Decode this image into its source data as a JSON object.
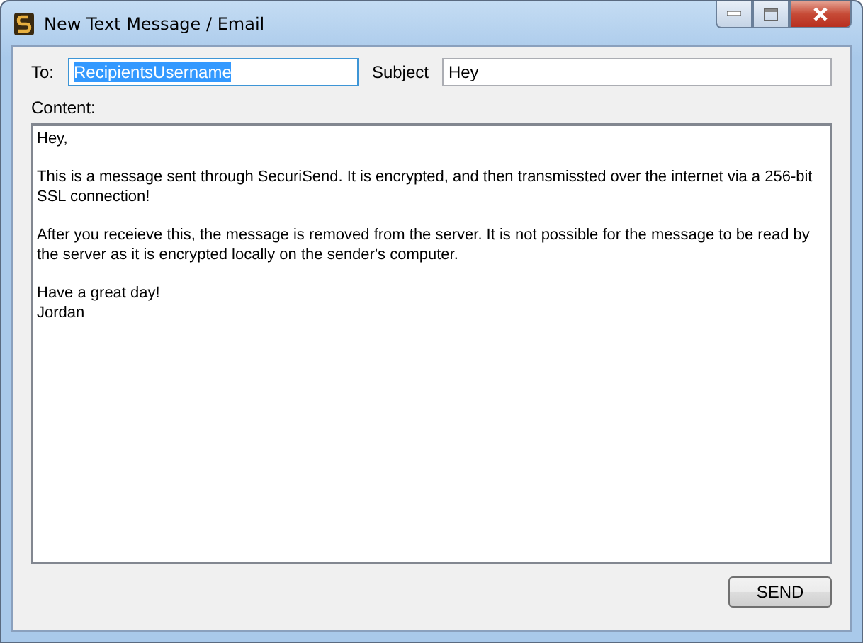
{
  "window": {
    "title": "New Text Message / Email"
  },
  "to": {
    "label": "To:",
    "value": "RecipientsUsername",
    "value_selected": true
  },
  "subject": {
    "label": "Subject",
    "value": "Hey"
  },
  "content": {
    "label": "Content:",
    "paragraphs": [
      [
        "Hey,"
      ],
      [
        "This is a message sent through SecuriSend. It is encrypted, and then transmissted over the internet via a 256-bit SSL connection!"
      ],
      [
        "After you receieve this, the message is removed from the server. It is not possible for the message to be read by the server as it is encrypted locally on the sender's computer."
      ],
      [
        "Have a great day!",
        "Jordan"
      ]
    ]
  },
  "buttons": [
    {
      "label": "SEND"
    }
  ]
}
